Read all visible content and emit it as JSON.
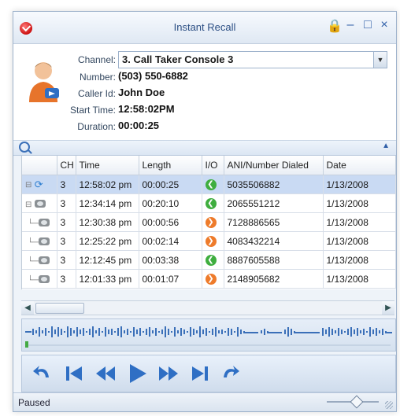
{
  "window": {
    "title": "Instant Recall",
    "controls": {
      "lock": "lock-icon",
      "minimize": "–",
      "maximize": "□",
      "close": "×"
    }
  },
  "caller_info": {
    "channel_label": "Channel:",
    "channel_value": "3. Call Taker Console 3",
    "number_label": "Number:",
    "number_value": "(503) 550-6882",
    "callerid_label": "Caller Id:",
    "callerid_value": "John Doe",
    "start_label": "Start Time:",
    "start_value": "12:58:02PM",
    "duration_label": "Duration:",
    "duration_value": "00:00:25"
  },
  "table": {
    "columns": [
      "",
      "CH",
      "Time",
      "Length",
      "I/O",
      "ANI/Number Dialed",
      "Date"
    ],
    "rows": [
      {
        "ch": "3",
        "time": "12:58:02 pm",
        "length": "00:00:25",
        "io": "in",
        "number": "5035506882",
        "date": "1/13/2008",
        "selected": true
      },
      {
        "ch": "3",
        "time": "12:34:14 pm",
        "length": "00:20:10",
        "io": "in",
        "number": "2065551212",
        "date": "1/13/2008"
      },
      {
        "ch": "3",
        "time": "12:30:38 pm",
        "length": "00:00:56",
        "io": "out",
        "number": "7128886565",
        "date": "1/13/2008"
      },
      {
        "ch": "3",
        "time": "12:25:22 pm",
        "length": "00:02:14",
        "io": "out",
        "number": "4083432214",
        "date": "1/13/2008"
      },
      {
        "ch": "3",
        "time": "12:12:45 pm",
        "length": "00:03:38",
        "io": "in",
        "number": "8887605588",
        "date": "1/13/2008"
      },
      {
        "ch": "3",
        "time": "12:01:33 pm",
        "length": "00:01:07",
        "io": "out",
        "number": "2148905682",
        "date": "1/13/2008"
      }
    ]
  },
  "status": {
    "text": "Paused"
  },
  "colors": {
    "accent": "#2f6fc4",
    "in": "#3fae3f",
    "out": "#ee7b2b",
    "selected_row": "#c9daf3"
  }
}
